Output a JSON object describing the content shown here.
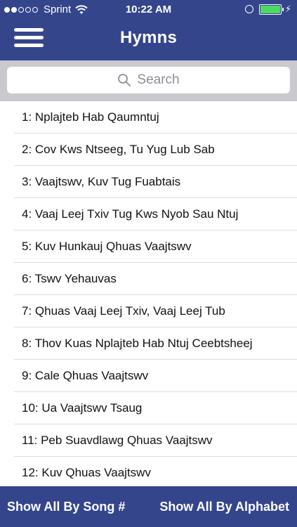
{
  "status_bar": {
    "carrier": "Sprint",
    "time": "10:22 AM",
    "battery_color": "#4cd964"
  },
  "header": {
    "title": "Hymns",
    "menu_icon": "hamburger-menu-icon"
  },
  "search": {
    "placeholder": "Search",
    "icon": "search-icon"
  },
  "hymns": [
    "1: Nplajteb Hab Qaumntuj",
    "2: Cov Kws Ntseeg, Tu Yug Lub Sab",
    "3: Vaajtswv, Kuv Tug Fuabtais",
    "4: Vaaj Leej Txiv Tug Kws Nyob Sau Ntuj",
    "5: Kuv Hunkauj Qhuas Vaajtswv",
    "6: Tswv Yehauvas",
    "7: Qhuas Vaaj Leej Txiv, Vaaj Leej Tub",
    "8: Thov Kuas Nplajteb Hab Ntuj Ceebtsheej",
    "9: Cale Qhuas Vaajtswv",
    "10: Ua Vaajtswv Tsaug",
    "11: Peb Suavdlawg Qhuas Vaajtswv",
    "12: Kuv Qhuas Vaajtswv"
  ],
  "footer": {
    "by_number_label": "Show All By Song #",
    "by_alphabet_label": "Show All By Alphabet"
  },
  "colors": {
    "header_bg": "#34458c",
    "search_bar_bg": "#c9c9ce"
  }
}
